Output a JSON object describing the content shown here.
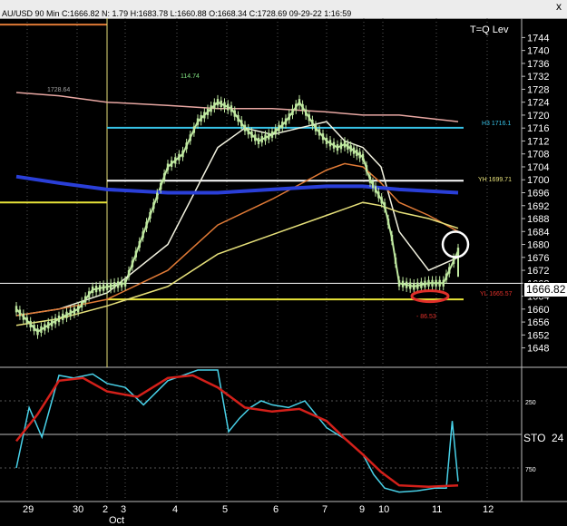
{
  "window": {
    "header_text": "AU/USD 90 Min  C:1666.82  N: 1.79  H:1683.78  L:1660.88  O:1668.34  C:1728.69  09-29-22 1:16:59",
    "close_glyph": "x"
  },
  "colors": {
    "price_line": "#bfe8a0",
    "ma_white": "#f2f2e0",
    "ma_orange": "#e07a36",
    "ma_yellow": "#e6e07a",
    "ma_pink": "#e8a7a2",
    "ma_blue": "#2a3fd8",
    "level_cyan": "#37c3e8",
    "level_yellow": "#e8e438",
    "stoch_cyan": "#48d1e8",
    "stoch_red": "#d4201a",
    "circle_white": "#ffffff",
    "circle_red": "#e0302a"
  },
  "chart_data": [
    {
      "type": "line",
      "panel": "price",
      "title": "T=Q Lev",
      "ylim": [
        1642,
        1750
      ],
      "y_ticks": [
        1648,
        1652,
        1656,
        1660,
        1664,
        1668,
        1672,
        1676,
        1680,
        1684,
        1688,
        1692,
        1696,
        1700,
        1704,
        1708,
        1712,
        1716,
        1720,
        1724,
        1728,
        1732,
        1736,
        1740,
        1744
      ],
      "x_ticks": [
        "29",
        "30",
        "2",
        "3",
        "4",
        "5",
        "6",
        "7",
        "9",
        "10",
        "11",
        "12"
      ],
      "x_sublabel": "Oct",
      "last_price_label": "1666.82",
      "last_price": 1666.82,
      "grid": "vertical dotted at day separators",
      "annotations": {
        "peak": {
          "text": "114.74",
          "value": 1729
        },
        "prev_high": {
          "text": "1728.64",
          "value": 1727.6
        },
        "h3": {
          "text": "H3 1716.1",
          "value": 1716.1
        },
        "yh": {
          "text": "YH 1699.71",
          "value": 1699.71
        },
        "yl": {
          "text": "YL 1665.57",
          "value": 1665.57
        },
        "low_label": {
          "text": "- 86.53",
          "value": 1659
        }
      },
      "levels": {
        "orange_top": 1748,
        "yellow_mid": 1693,
        "yellow_low": 1663,
        "white_hl": 1668
      },
      "series": [
        {
          "color_key": "price_line",
          "x": [
            0,
            0.5,
            1,
            1.4,
            1.7,
            2.3,
            3,
            3.3,
            3.6,
            4,
            4.25,
            4.5,
            4.75,
            5,
            5.25,
            5.5,
            5.8,
            6,
            6.3,
            6.5,
            6.75,
            7,
            7.2,
            7.35,
            7.6,
            7.8,
            8,
            8.25,
            8.5,
            8.75,
            8.85,
            9,
            9.1
          ],
          "values": [
            1660,
            1653,
            1657,
            1660,
            1666,
            1668,
            1704,
            1708,
            1718,
            1724,
            1722,
            1716,
            1712,
            1714,
            1718,
            1724,
            1716,
            1712,
            1710,
            1711,
            1709,
            1707,
            1700,
            1697,
            1692,
            1682,
            1668,
            1667,
            1668,
            1668,
            1672,
            1678,
            1670
          ]
        },
        {
          "color_key": "ma_white",
          "x": [
            0,
            1,
            2,
            3,
            4,
            4.5,
            5,
            5.5,
            6,
            6.5,
            7,
            7.5,
            8,
            8.5,
            9
          ],
          "values": [
            1658,
            1660,
            1665,
            1680,
            1710,
            1716,
            1714,
            1716,
            1718,
            1712,
            1710,
            1704,
            1684,
            1672,
            1676
          ]
        },
        {
          "color_key": "ma_orange",
          "x": [
            0,
            1,
            2,
            3,
            4,
            5,
            6,
            6.5,
            7,
            7.5,
            8,
            8.5,
            9
          ],
          "values": [
            1658,
            1660,
            1663,
            1672,
            1686,
            1694,
            1703,
            1705,
            1704,
            1699,
            1693,
            1689,
            1684
          ]
        },
        {
          "color_key": "ma_yellow",
          "x": [
            0,
            1,
            2,
            3,
            4,
            5,
            6,
            7,
            7.5,
            8,
            8.5,
            9
          ],
          "values": [
            1655,
            1657,
            1661,
            1667,
            1677,
            1683,
            1689,
            1693,
            1692,
            1690,
            1688,
            1685
          ]
        },
        {
          "color_key": "ma_pink",
          "x": [
            0,
            1,
            2,
            3,
            4,
            5,
            6,
            7,
            8,
            9
          ],
          "values": [
            1727,
            1726,
            1724,
            1723,
            1722,
            1722,
            1721,
            1720,
            1720,
            1718
          ]
        },
        {
          "color_key": "ma_blue",
          "x": [
            0,
            1,
            2,
            3,
            4,
            5,
            6,
            7,
            8,
            9
          ],
          "values": [
            1701,
            1699,
            1697,
            1696,
            1696,
            1697,
            1698,
            1698,
            1697,
            1696
          ]
        }
      ]
    },
    {
      "type": "line",
      "panel": "stochastic",
      "title": "STO",
      "title_value": "24",
      "ylim": [
        0,
        1000
      ],
      "y_ticks": [
        250,
        750
      ],
      "series": [
        {
          "color_key": "stoch_cyan",
          "x": [
            0,
            0.3,
            0.6,
            1,
            1.3,
            1.7,
            2,
            2.3,
            2.6,
            3,
            3.3,
            3.6,
            4,
            4.2,
            4.4,
            4.6,
            4.8,
            5,
            5.3,
            5.6,
            6,
            6.3,
            6.6,
            7,
            7.3,
            7.6,
            8,
            8.3,
            8.6,
            8.8,
            8.9,
            9
          ],
          "values": [
            750,
            300,
            520,
            60,
            80,
            50,
            120,
            150,
            280,
            100,
            60,
            20,
            20,
            480,
            380,
            300,
            250,
            280,
            300,
            250,
            450,
            500,
            550,
            650,
            800,
            900,
            930,
            920,
            900,
            900,
            400,
            850
          ]
        },
        {
          "color_key": "stoch_red",
          "x": [
            0,
            0.5,
            1,
            1.5,
            2,
            2.5,
            3,
            3.5,
            4,
            4.5,
            5,
            5.5,
            6,
            6.5,
            7,
            7.5,
            8,
            8.5,
            9
          ],
          "values": [
            550,
            350,
            100,
            80,
            180,
            220,
            80,
            60,
            150,
            300,
            330,
            310,
            400,
            530,
            650,
            780,
            880,
            890,
            880
          ]
        }
      ]
    }
  ]
}
